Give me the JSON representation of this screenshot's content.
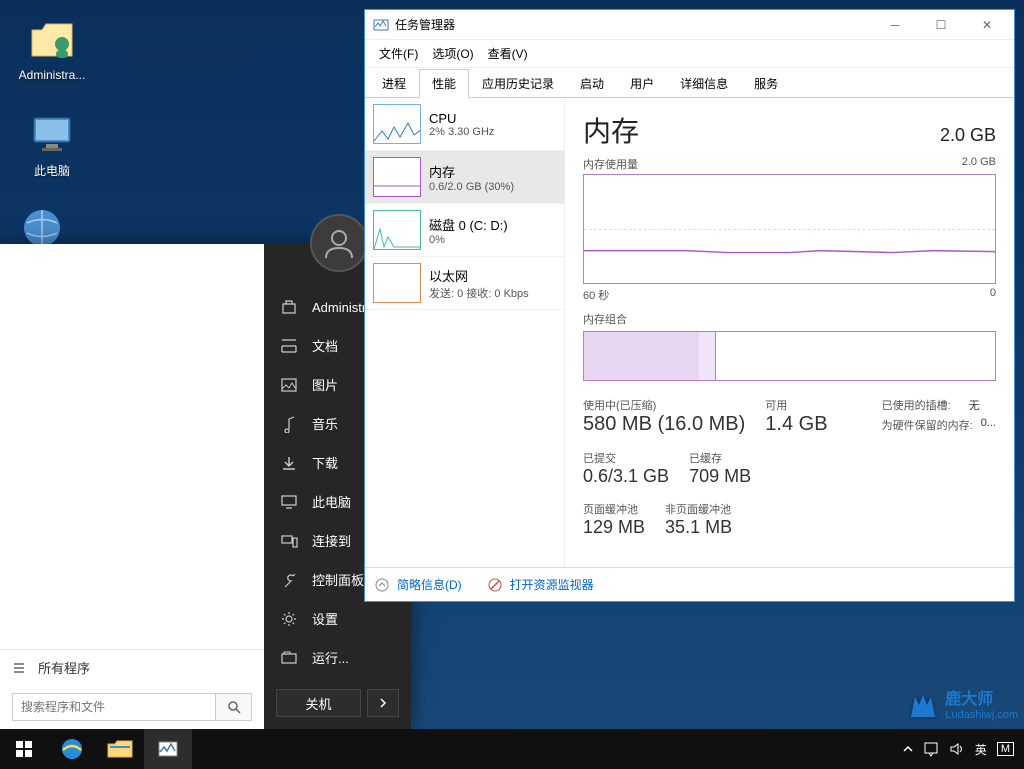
{
  "desktop_icons": [
    {
      "label": "Administra..."
    },
    {
      "label": "此电脑"
    }
  ],
  "start_menu": {
    "all_programs": "所有程序",
    "search_placeholder": "搜索程序和文件",
    "items": [
      {
        "icon": "user",
        "label": "Administrator"
      },
      {
        "icon": "doc",
        "label": "文档"
      },
      {
        "icon": "pic",
        "label": "图片"
      },
      {
        "icon": "music",
        "label": "音乐"
      },
      {
        "icon": "download",
        "label": "下载"
      },
      {
        "icon": "pc",
        "label": "此电脑"
      },
      {
        "icon": "connect",
        "label": "连接到"
      },
      {
        "icon": "control",
        "label": "控制面板"
      },
      {
        "icon": "settings",
        "label": "设置"
      },
      {
        "icon": "run",
        "label": "运行..."
      }
    ],
    "shutdown": "关机"
  },
  "task_manager": {
    "title": "任务管理器",
    "menu": {
      "file": "文件(F)",
      "options": "选项(O)",
      "view": "查看(V)"
    },
    "tabs": [
      "进程",
      "性能",
      "应用历史记录",
      "启动",
      "用户",
      "详细信息",
      "服务"
    ],
    "active_tab": 1,
    "sidebar": [
      {
        "label": "CPU",
        "sub": "2% 3.30 GHz"
      },
      {
        "label": "内存",
        "sub": "0.6/2.0 GB (30%)"
      },
      {
        "label": "磁盘 0 (C: D:)",
        "sub": "0%"
      },
      {
        "label": "以太网",
        "sub": "发送: 0 接收: 0 Kbps"
      }
    ],
    "main": {
      "title": "内存",
      "total": "2.0 GB",
      "usage_label": "内存使用量",
      "usage_max": "2.0 GB",
      "axis_left": "60 秒",
      "axis_right": "0",
      "composition_label": "内存组合",
      "stats": {
        "in_use_label": "使用中(已压缩)",
        "in_use_value": "580 MB (16.0 MB)",
        "available_label": "可用",
        "available_value": "1.4 GB",
        "committed_label": "已提交",
        "committed_value": "0.6/3.1 GB",
        "cached_label": "已缓存",
        "cached_value": "709 MB",
        "paged_label": "页面缓冲池",
        "paged_value": "129 MB",
        "nonpaged_label": "非页面缓冲池",
        "nonpaged_value": "35.1 MB",
        "slots_label": "已使用的插槽:",
        "slots_value": "无",
        "reserved_label": "为硬件保留的内存:",
        "reserved_value": "0..."
      }
    },
    "footer_less": "简略信息(D)",
    "footer_link": "打开资源监视器"
  },
  "tray": {
    "ime1": "英",
    "ime2": "M"
  },
  "watermark": {
    "brand": "鹿大师",
    "url": "Ludashiwj.com"
  },
  "chart_data": {
    "type": "area",
    "title": "内存使用量",
    "xlabel": "60 秒",
    "ylabel": "",
    "ylim": [
      0,
      2.0
    ],
    "y_unit": "GB",
    "x_seconds": [
      60,
      55,
      50,
      45,
      40,
      35,
      30,
      25,
      20,
      15,
      10,
      5,
      0
    ],
    "values_gb": [
      0.6,
      0.6,
      0.6,
      0.6,
      0.6,
      0.58,
      0.58,
      0.58,
      0.6,
      0.6,
      0.58,
      0.58,
      0.6
    ],
    "composition": {
      "in_use_gb": 0.58,
      "compressed_gb": 0.016,
      "cached_gb": 0.709,
      "available_gb": 1.4,
      "total_gb": 2.0
    }
  }
}
